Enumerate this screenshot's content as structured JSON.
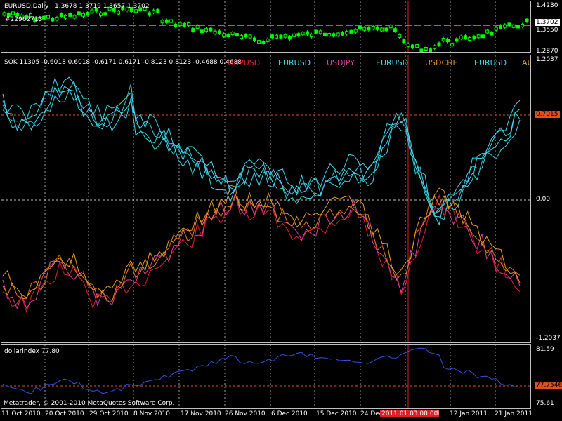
{
  "price_pane": {
    "title": "EURUSD,Daily",
    "ohlc": "1.3678 1.3719 1.3657 1.3702",
    "account": "#22962713",
    "level_color": "#00ff00",
    "candle_color": "#00ff00"
  },
  "sok_pane": {
    "title": "SOK 11305 -0.6018 0.6018 -0.6171 0.6171 -0.8123 0.8123 -0.4688 0.4688",
    "legend": [
      {
        "label": "GBPUSD",
        "color": "#e82020"
      },
      {
        "label": "EURUSD",
        "color": "#3fd6ea"
      },
      {
        "label": "USDJPY",
        "color": "#e040a0"
      },
      {
        "label": "EURUSD",
        "color": "#3fd6ea"
      },
      {
        "label": "USDCHF",
        "color": "#e08020"
      },
      {
        "label": "EURUSD",
        "color": "#3fd6ea"
      },
      {
        "label": "AU",
        "color": "#e8a020"
      }
    ]
  },
  "dollar_pane": {
    "title": "dollarindex 77.80",
    "copyright": "Metatrader, © 2001-2010 MetaQuotes Software Corp.",
    "line_color": "#3a4fe0"
  },
  "price_axis": {
    "top": "1.4230",
    "current": "1.3702",
    "mid": "1.3550",
    "bottom": "1.2870"
  },
  "sok_axis": {
    "top": "1.2037",
    "level": "0.7015",
    "zero": "0.00",
    "bottom": "-1.2037"
  },
  "dx_axis": {
    "top": "81.59",
    "current": "77.7546",
    "bottom": "75.61"
  },
  "x_axis": {
    "dates": [
      "11 Oct 2010",
      "20 Oct 2010",
      "29 Oct 2010",
      "8 Nov 2010",
      "17 Nov 2010",
      "26 Nov 2010",
      "6 Dec 2010",
      "15 Dec 2010",
      "24 Dec",
      "12 Jan 2011",
      "21 Jan 2011"
    ],
    "cursor_label": "2011.01.03 00:00",
    "cursor_suffix": "1"
  },
  "colors": {
    "background": "#000000",
    "grid": "#a0a0a0",
    "cursor": "#e02020",
    "level_line": "#e05020"
  }
}
